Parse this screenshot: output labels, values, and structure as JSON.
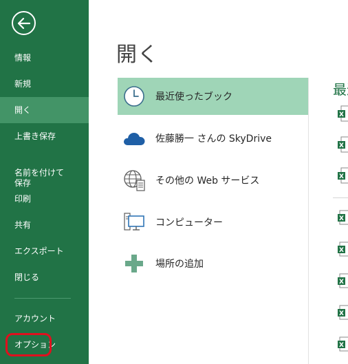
{
  "sidebar": {
    "items": [
      {
        "label": "情報"
      },
      {
        "label": "新規"
      },
      {
        "label": "開く"
      },
      {
        "label": "上書き保存"
      },
      {
        "label": "名前を付けて\n保存"
      },
      {
        "label": "印刷"
      },
      {
        "label": "共有"
      },
      {
        "label": "エクスポート"
      },
      {
        "label": "閉じる"
      },
      {
        "label": "アカウント"
      },
      {
        "label": "オプション"
      }
    ]
  },
  "main": {
    "title": "開く",
    "places": [
      {
        "label": "最近使ったブック",
        "icon": "clock-icon"
      },
      {
        "label": "佐藤勝一 さんの SkyDrive",
        "icon": "skydrive-cloud-icon"
      },
      {
        "label": "その他の Web サービス",
        "icon": "web-services-globe-icon"
      },
      {
        "label": "コンピューター",
        "icon": "computer-icon"
      },
      {
        "label": "場所の追加",
        "icon": "add-place-icon"
      }
    ],
    "recent_heading": "最近使ったブック"
  },
  "colors": {
    "sidebar_bg": "#217346",
    "sidebar_active": "#439467",
    "selected_place": "#9fd5b7",
    "highlight_red": "#e0101e",
    "excel_green": "#217346"
  }
}
